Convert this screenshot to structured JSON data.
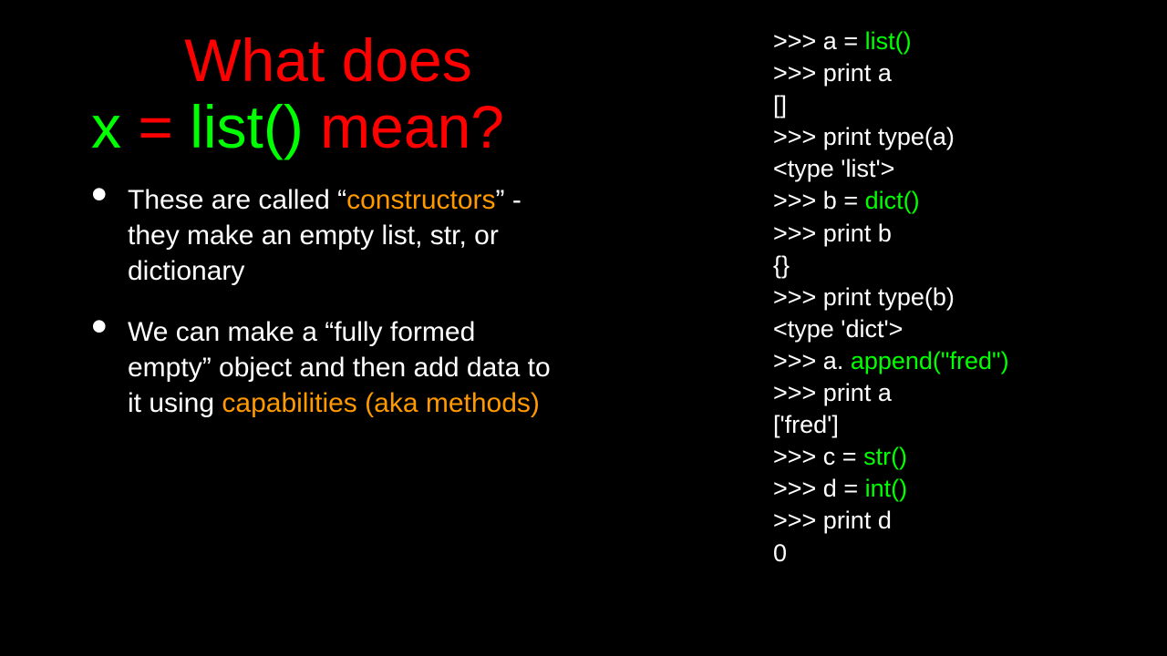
{
  "title": {
    "line1_pre": "What does",
    "line2_x": "x",
    "line2_eq": " = ",
    "line2_list": "list()",
    "line2_mean": " mean?"
  },
  "bullets": [
    {
      "pre": "These are called “",
      "hl": "constructors",
      "post": "”  - they make an empty list, str, or dictionary"
    },
    {
      "pre": "We can make a “fully formed empty” object and then add data to it using ",
      "hl": "capabilities (aka methods)",
      "post": ""
    }
  ],
  "code": [
    {
      "p": ">>> a = ",
      "g": "list()",
      "s": ""
    },
    {
      "p": ">>> print a",
      "g": "",
      "s": ""
    },
    {
      "p": "[]",
      "g": "",
      "s": ""
    },
    {
      "p": ">>> print type(a)",
      "g": "",
      "s": ""
    },
    {
      "p": "<type 'list'>",
      "g": "",
      "s": ""
    },
    {
      "p": ">>> b = ",
      "g": "dict()",
      "s": ""
    },
    {
      "p": ">>> print b",
      "g": "",
      "s": ""
    },
    {
      "p": "{}",
      "g": "",
      "s": ""
    },
    {
      "p": ">>> print type(b)",
      "g": "",
      "s": ""
    },
    {
      "p": "<type 'dict'>",
      "g": "",
      "s": ""
    },
    {
      "p": ">>> a. ",
      "g": "append(\"fred\")",
      "s": ""
    },
    {
      "p": ">>> print a",
      "g": "",
      "s": ""
    },
    {
      "p": "['fred']",
      "g": "",
      "s": ""
    },
    {
      "p": ">>> c = ",
      "g": "str()",
      "s": ""
    },
    {
      "p": ">>> d = ",
      "g": "int()",
      "s": ""
    },
    {
      "p": ">>> print d",
      "g": "",
      "s": ""
    },
    {
      "p": "0",
      "g": "",
      "s": ""
    }
  ]
}
